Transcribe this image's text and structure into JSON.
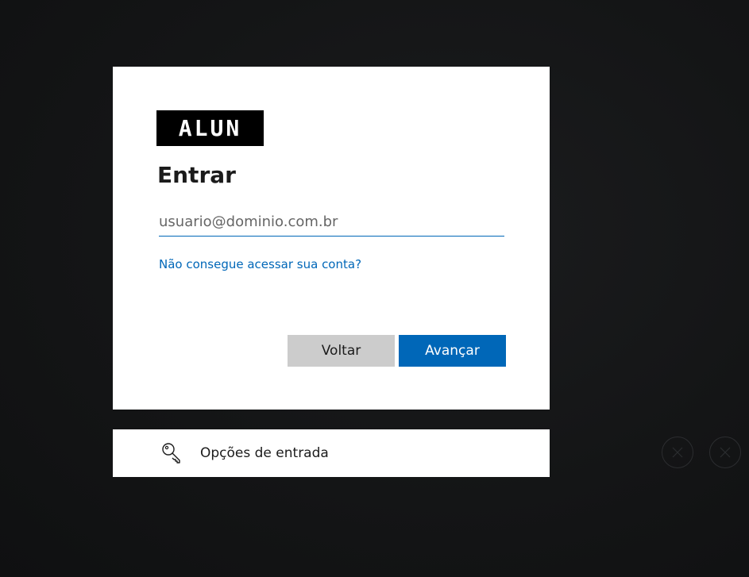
{
  "brand": {
    "logo_text": "ALUN"
  },
  "signin": {
    "title": "Entrar",
    "email_placeholder": "usuario@dominio.com.br",
    "email_value": "",
    "help_link": "Não consegue acessar sua conta?",
    "back_label": "Voltar",
    "next_label": "Avançar"
  },
  "options": {
    "label": "Opções de entrada",
    "icon": "key-icon"
  },
  "colors": {
    "accent": "#0067b8",
    "secondary_button": "#cccccc",
    "background": "#141516"
  }
}
